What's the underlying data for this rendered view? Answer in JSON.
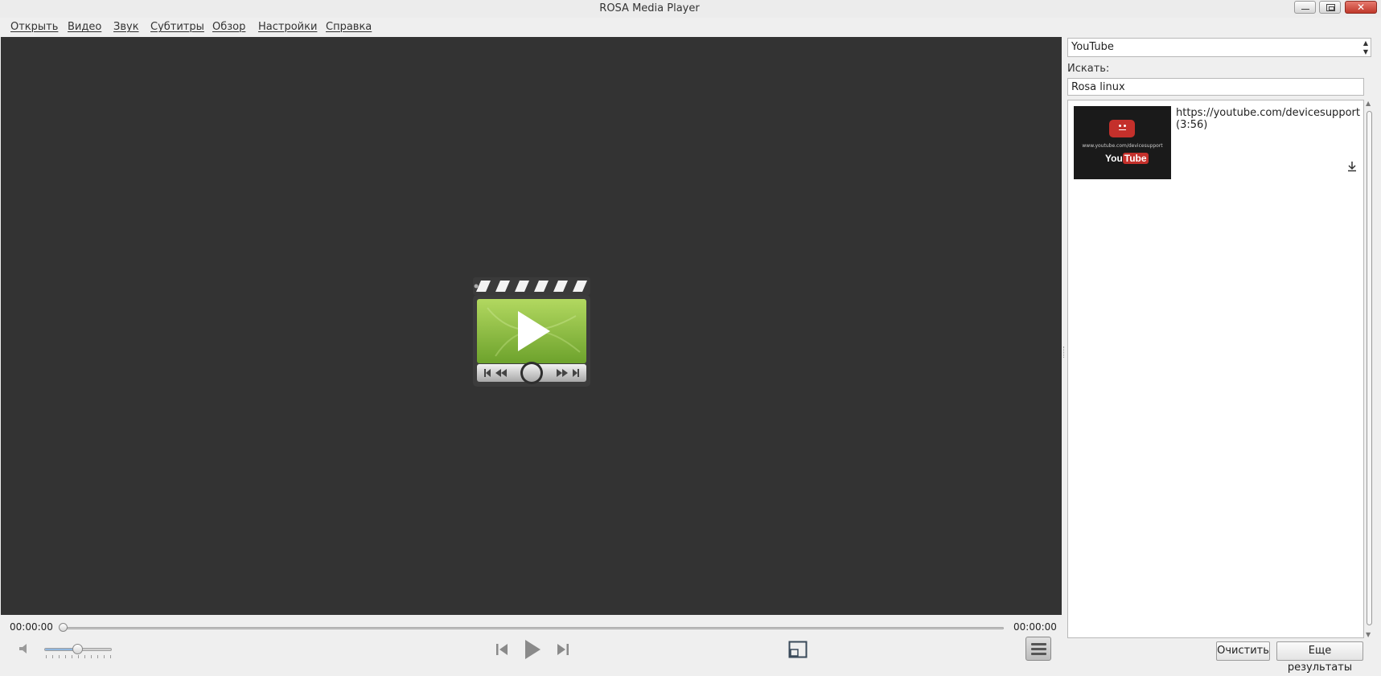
{
  "window": {
    "title": "ROSA Media Player",
    "controls": {
      "minimize_icon": "minimize-icon",
      "maximize_icon": "maximize-icon",
      "close_icon": "close-icon"
    }
  },
  "menu": {
    "items": [
      "Открыть",
      "Видео",
      "Звук",
      "Субтитры",
      "Обзор",
      "Настройки",
      "Справка"
    ]
  },
  "sidebar": {
    "source": "YouTube",
    "search_label": "Искать:",
    "search_value": "Rosa linux",
    "results": [
      {
        "title": "https://youtube.com/devicesupport",
        "duration": "(3:56)",
        "thumbnail_url_text": "www.youtube.com/devicesupport",
        "thumbnail_logo_left": "You",
        "thumbnail_logo_right": "Tube"
      }
    ],
    "clear_button": "Очистить",
    "more_button": "Еще результаты"
  },
  "player": {
    "current_time": "00:00:00",
    "total_time": "00:00:00",
    "progress": 0,
    "volume": 0.5
  },
  "colors": {
    "video_background": "#333333",
    "accent_green": "#8dc63f",
    "youtube_red": "#c4302b"
  }
}
